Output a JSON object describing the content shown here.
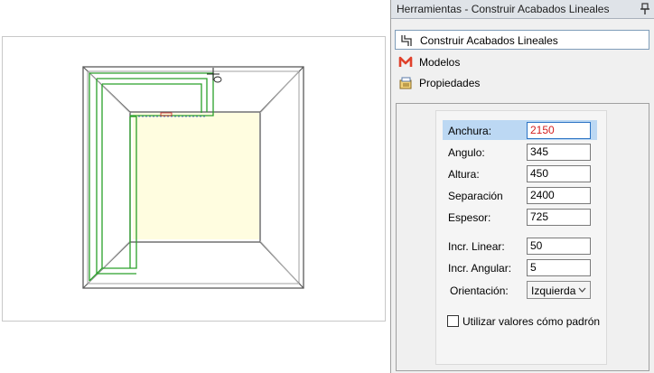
{
  "panel": {
    "title": "Herramientas - Construir Acabados Lineales",
    "pin_icon": "pin-icon"
  },
  "nav": {
    "items": [
      {
        "label": "Construir Acabados Lineales",
        "icon": "linear-finish-icon",
        "active": true
      },
      {
        "label": "Modelos",
        "icon": "models-m-icon",
        "active": false
      },
      {
        "label": "Propiedades",
        "icon": "properties-icon",
        "active": false
      }
    ]
  },
  "properties": {
    "anchura": {
      "label": "Anchura:",
      "value": "2150"
    },
    "angulo": {
      "label": "Angulo:",
      "value": "345"
    },
    "altura": {
      "label": "Altura:",
      "value": "450"
    },
    "separacion": {
      "label": "Separación",
      "value": "2400"
    },
    "espesor": {
      "label": "Espesor:",
      "value": "725"
    },
    "incr_linear": {
      "label": "Incr. Linear:",
      "value": "50"
    },
    "incr_angular": {
      "label": "Incr. Angular:",
      "value": "5"
    },
    "orientacion": {
      "label": "Orientación:",
      "value": "Izquierda"
    },
    "default_checkbox": {
      "label": "Utilizar valores cómo padrón",
      "checked": false
    }
  },
  "viewport": {
    "floor_color": "#fffde0",
    "wall_line_color": "#555555",
    "finish_line_color": "#2aa02a"
  }
}
